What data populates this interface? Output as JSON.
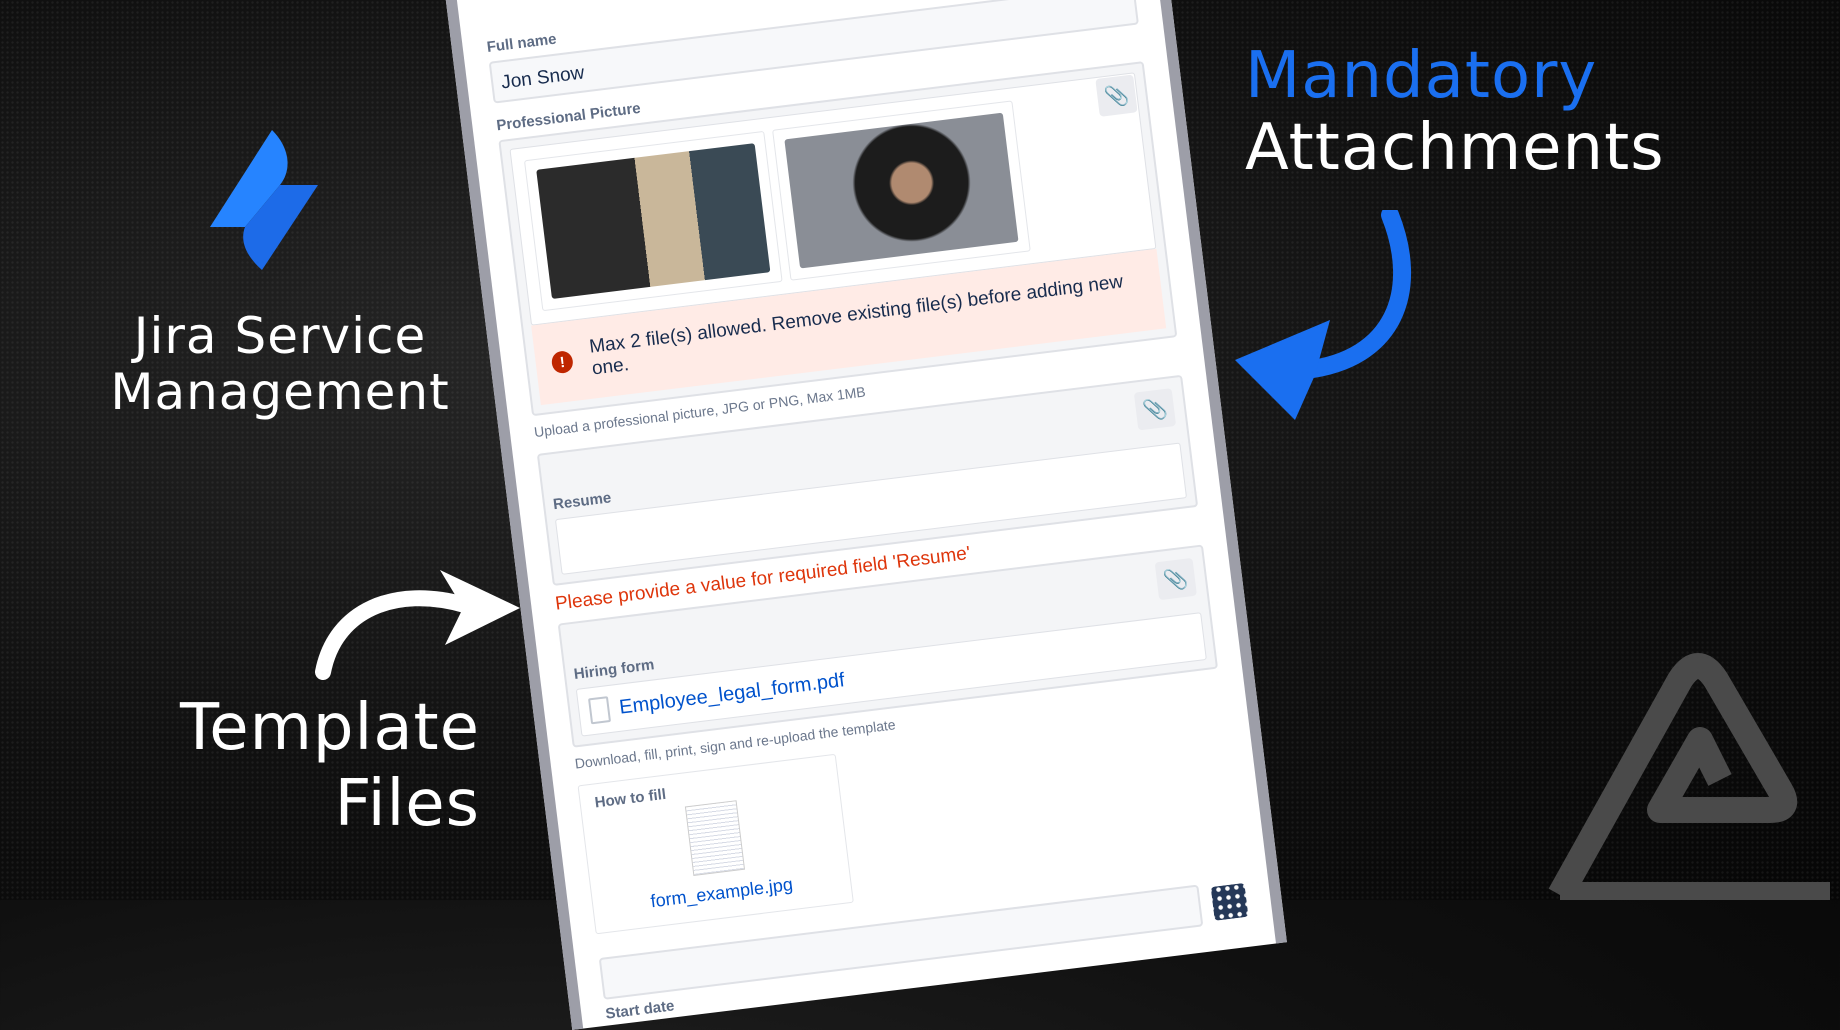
{
  "hero": {
    "jira_line1": "Jira Service",
    "jira_line2": "Management",
    "template_line1": "Template",
    "template_line2": "Files",
    "mandatory": "Mandatory",
    "attachments": "Attachments"
  },
  "colors": {
    "accent": "#1a6ff0",
    "error": "#de350b",
    "link": "#0052cc"
  },
  "form": {
    "full_name": {
      "label": "Full name",
      "value": "Jon Snow"
    },
    "picture": {
      "label": "Professional Picture",
      "error": "Max 2 file(s) allowed. Remove existing file(s) before adding new one.",
      "help": "Upload a professional picture, JPG or PNG, Max 1MB"
    },
    "resume": {
      "label": "Resume",
      "error": "Please provide a value for required field 'Resume'"
    },
    "hiring": {
      "label": "Hiring form",
      "file": "Employee_legal_form.pdf",
      "help": "Download, fill, print, sign and re-upload the template"
    },
    "how_to": {
      "label": "How to fill",
      "file": "form_example.jpg"
    },
    "start_date": {
      "label": "Start date"
    }
  }
}
